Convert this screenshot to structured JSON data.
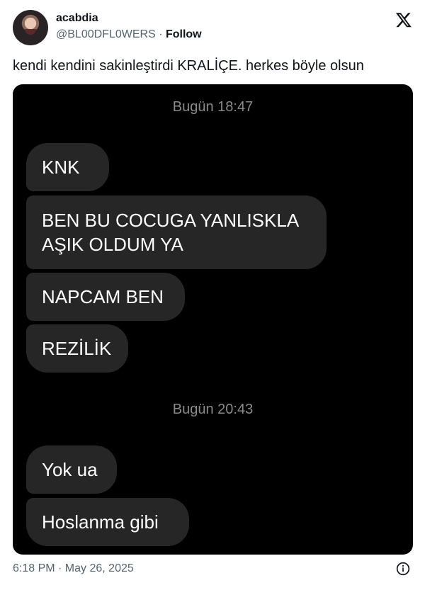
{
  "author": {
    "display_name": "acabdia",
    "handle": "@BL00DFL0WERS",
    "separator": "·",
    "follow_label": "Follow"
  },
  "platform_icon": "x-logo-icon",
  "tweet_text": "kendi kendini sakinleştirdi KRALİÇE. herkes böyle olsun",
  "chat": {
    "timestamp_1": "Bugün 18:47",
    "messages_group_1": [
      "KNK",
      "BEN BU COCUGA YANLISKLA",
      "AŞIK OLDUM YA",
      "NAPCAM BEN",
      "REZİLİK"
    ],
    "timestamp_2": "Bugün 20:43",
    "messages_group_2": [
      "Yok ua",
      "Hoslanma gibi"
    ]
  },
  "footer": {
    "posted_at": "6:18 PM · May 26, 2025",
    "info_icon": "info-icon"
  },
  "colors": {
    "media_background": "#000000",
    "bubble_background": "#262626",
    "timestamp_gray": "#8a8a8a",
    "secondary_text": "#536471"
  }
}
